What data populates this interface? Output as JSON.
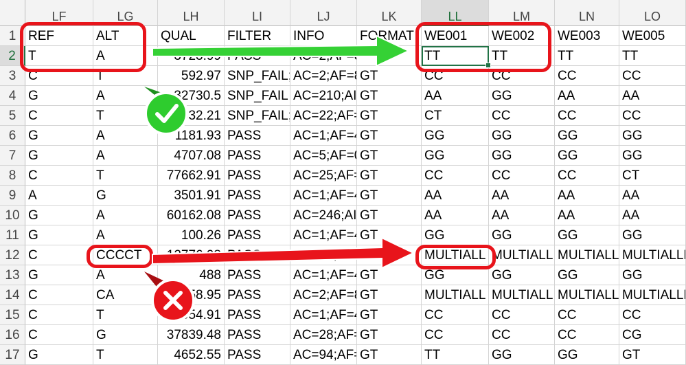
{
  "columns": [
    "LF",
    "LG",
    "LH",
    "LI",
    "LJ",
    "LK",
    "LL",
    "LM",
    "LN",
    "LO"
  ],
  "selected_column": "LL",
  "selected_row": "2",
  "rows": [
    {
      "n": "1",
      "cells": [
        "REF",
        "ALT",
        "QUAL",
        "FILTER",
        "INFO",
        "FORMAT",
        "WE001",
        "WE002",
        "WE003",
        "WE005"
      ]
    },
    {
      "n": "2",
      "cells": [
        "T",
        "A",
        "3723.99",
        "PASS",
        "AC=2;AF=8",
        "",
        "TT",
        "TT",
        "TT",
        "TT"
      ]
    },
    {
      "n": "3",
      "cells": [
        "C",
        "T",
        "592.97",
        "SNP_FAIL;",
        "AC=2;AF=8",
        "GT",
        "CC",
        "CC",
        "CC",
        "CC"
      ]
    },
    {
      "n": "4",
      "cells": [
        "G",
        "A",
        "32730.5",
        "SNP_FAIL",
        "AC=210;AI",
        "GT",
        "AA",
        "GG",
        "AA",
        "AA"
      ]
    },
    {
      "n": "5",
      "cells": [
        "C",
        "T",
        "332.21",
        "SNP_FAIL;",
        "AC=22;AF=",
        "GT",
        "CT",
        "CC",
        "CC",
        "CC"
      ]
    },
    {
      "n": "6",
      "cells": [
        "G",
        "A",
        "1181.93",
        "PASS",
        "AC=1;AF=4",
        "GT",
        "GG",
        "GG",
        "GG",
        "GG"
      ]
    },
    {
      "n": "7",
      "cells": [
        "G",
        "A",
        "4707.08",
        "PASS",
        "AC=5;AF=0",
        "GT",
        "GG",
        "GG",
        "GG",
        "GG"
      ]
    },
    {
      "n": "8",
      "cells": [
        "C",
        "T",
        "77662.91",
        "PASS",
        "AC=25;AF=",
        "GT",
        "CC",
        "CC",
        "CC",
        "CT"
      ]
    },
    {
      "n": "9",
      "cells": [
        "A",
        "G",
        "3501.91",
        "PASS",
        "AC=1;AF=4",
        "GT",
        "AA",
        "AA",
        "AA",
        "AA"
      ]
    },
    {
      "n": "10",
      "cells": [
        "G",
        "A",
        "60162.08",
        "PASS",
        "AC=246;AI",
        "GT",
        "AA",
        "AA",
        "AA",
        "AA"
      ]
    },
    {
      "n": "11",
      "cells": [
        "G",
        "A",
        "100.26",
        "PASS",
        "AC=1;AF=4",
        "GT",
        "GG",
        "GG",
        "GG",
        "GG"
      ]
    },
    {
      "n": "12",
      "cells": [
        "C",
        "CCCCT",
        "12776.98",
        "PASS",
        "AC=12;AF=",
        "GT",
        "MULTIALL",
        "MULTIALL",
        "MULTIALL",
        "MULTIALLE"
      ]
    },
    {
      "n": "13",
      "cells": [
        "G",
        "A",
        "488",
        "PASS",
        "AC=1;AF=4",
        "GT",
        "GG",
        "GG",
        "GG",
        "GG"
      ]
    },
    {
      "n": "14",
      "cells": [
        "C",
        "CA",
        "2258.95",
        "PASS",
        "AC=2;AF=8",
        "GT",
        "MULTIALL",
        "MULTIALL",
        "MULTIALL",
        "MULTIALLE"
      ]
    },
    {
      "n": "15",
      "cells": [
        "C",
        "T",
        "2054.91",
        "PASS",
        "AC=1;AF=4",
        "GT",
        "CC",
        "CC",
        "CC",
        "CC"
      ]
    },
    {
      "n": "16",
      "cells": [
        "C",
        "G",
        "37839.48",
        "PASS",
        "AC=28;AF=",
        "GT",
        "CC",
        "CC",
        "CC",
        "CG"
      ]
    },
    {
      "n": "17",
      "cells": [
        "G",
        "T",
        "4652.55",
        "PASS",
        "AC=94;AF=",
        "GT",
        "TT",
        "GG",
        "GG",
        "GT"
      ]
    }
  ],
  "annotations": {
    "check_icon": "check-icon",
    "cross_icon": "cross-icon",
    "green": "#2ecc2e",
    "red": "#e8141b"
  }
}
